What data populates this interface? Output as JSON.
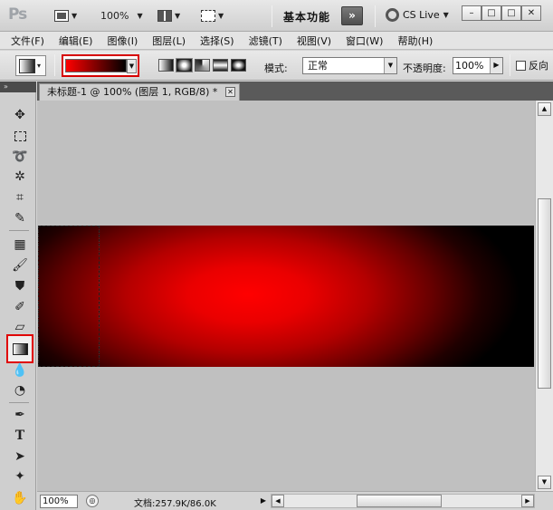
{
  "app": {
    "logo": "Ps",
    "zoom_menu": "100%",
    "workspace_label": "基本功能",
    "more_label": "»",
    "cslive_label": "CS Live",
    "win_minimize": "–",
    "win_restore": "□",
    "win_close": "✕"
  },
  "menubar": {
    "items": [
      "文件(F)",
      "编辑(E)",
      "图像(I)",
      "图层(L)",
      "选择(S)",
      "滤镜(T)",
      "视图(V)",
      "窗口(W)",
      "帮助(H)"
    ]
  },
  "options": {
    "gradient_colors": [
      "#ff0000",
      "#000000"
    ],
    "mode_label": "模式:",
    "mode_value": "正常",
    "opacity_label": "不透明度:",
    "opacity_value": "100%",
    "reverse_label": "反向",
    "gradient_types": [
      "linear",
      "radial",
      "angle",
      "reflected",
      "diamond"
    ],
    "selected_gradient_type": "radial"
  },
  "toolstrip": {
    "collapse_glyph": "»"
  },
  "document": {
    "tab_title": "未标题-1 @ 100% (图层 1, RGB/8) *",
    "tab_close": "✕"
  },
  "status": {
    "zoom": "100%",
    "doc_size": "文档:257.9K/86.0K",
    "arrow": "▶"
  },
  "tools": {
    "active": "gradient-tool"
  }
}
